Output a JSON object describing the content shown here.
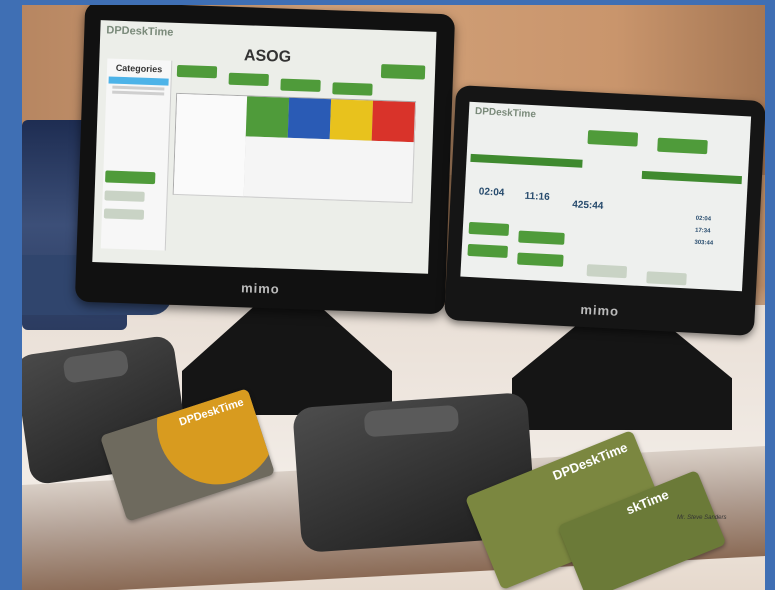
{
  "monitor_large": {
    "brand": "mimo",
    "logo": "DPDeskTime",
    "title": "ASOG",
    "categories_heading": "Categories"
  },
  "monitor_small": {
    "brand": "mimo",
    "logo": "DPDeskTime",
    "times": [
      "02:04",
      "11:16",
      "425:44"
    ],
    "side_times": [
      "02:04",
      "17:34",
      "303:44"
    ]
  },
  "cards": {
    "card1_logo": "DPDeskTime",
    "card2_logo": "DPDeskTime",
    "card3_logo": "skTime"
  },
  "caption": "Mr. Steve Sanders",
  "colors": {
    "screen_green": "#4f9b3a",
    "wall": "#c9986f",
    "frame": "#3f6fb4"
  }
}
